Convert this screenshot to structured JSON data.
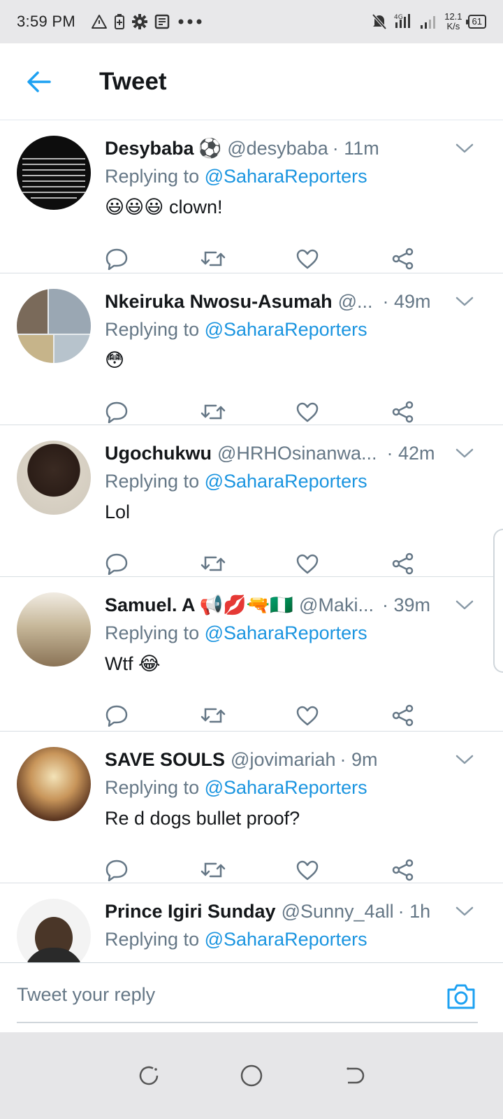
{
  "status_bar": {
    "time": "3:59 PM",
    "net_type": "4G",
    "speed_value": "12.1",
    "speed_unit": "K/s",
    "battery": "61"
  },
  "header": {
    "title": "Tweet"
  },
  "colors": {
    "accent": "#1da1f2",
    "mention": "#1b95e0",
    "secondary_text": "#657786"
  },
  "tweets": [
    {
      "name": "Desybaba",
      "name_emojis": "⚽",
      "handle": "@desybaba",
      "time": "· 11m",
      "reply_prefix": "Replying to",
      "reply_mention": "@SaharaReporters",
      "body": "clown!",
      "body_emojis": "😃😃😃"
    },
    {
      "name": "Nkeiruka Nwosu-Asumah",
      "handle": "@...",
      "time": "· 49m",
      "reply_prefix": "Replying to",
      "reply_mention": "@SaharaReporters",
      "body": "",
      "body_emojis": "😳"
    },
    {
      "name": "Ugochukwu",
      "handle": "@HRHOsinanwa...",
      "time": "· 42m",
      "reply_prefix": "Replying to",
      "reply_mention": "@SaharaReporters",
      "body": "Lol"
    },
    {
      "name": "Samuel. A",
      "name_emojis": "📢💋🔫🇳🇬",
      "handle": "@Maki...",
      "time": "· 39m",
      "reply_prefix": "Replying to",
      "reply_mention": "@SaharaReporters",
      "body": "Wtf",
      "body_emojis": "😂"
    },
    {
      "name": "SAVE SOULS",
      "handle": "@jovimariah",
      "time": "· 9m",
      "reply_prefix": "Replying to",
      "reply_mention": "@SaharaReporters",
      "body": "Re d dogs bullet proof?"
    },
    {
      "name": "Prince Igiri Sunday",
      "handle": "@Sunny_4all",
      "time": "· 1h",
      "reply_prefix": "Replying to",
      "reply_mention": "@SaharaReporters",
      "body": ""
    }
  ],
  "reply_bar": {
    "placeholder": "Tweet your reply"
  },
  "icons": {
    "back": "arrow-left-icon",
    "caret": "chevron-down-icon",
    "reply": "reply-icon",
    "retweet": "retweet-icon",
    "like": "heart-icon",
    "share": "share-icon",
    "camera": "camera-icon"
  }
}
